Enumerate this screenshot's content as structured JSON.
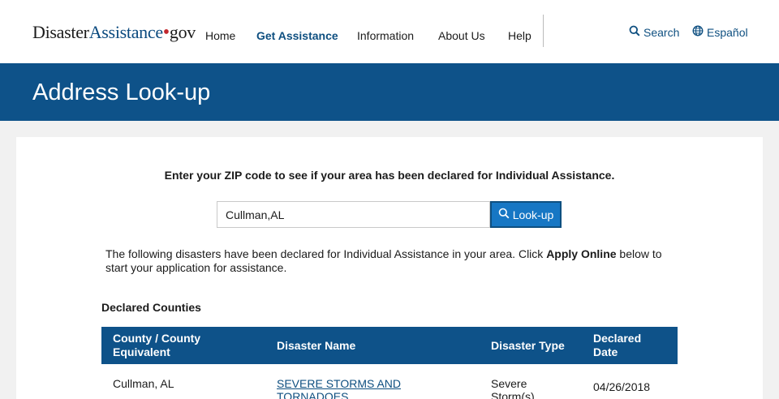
{
  "header": {
    "logo": {
      "part1": "Disaster",
      "part2": "Assistance",
      "dot": "•",
      "part3": "gov"
    },
    "nav": [
      {
        "label": "Home"
      },
      {
        "label": "Get Assistance"
      },
      {
        "label": "Information"
      },
      {
        "label": "About Us"
      },
      {
        "label": "Help"
      }
    ],
    "search_label": "Search",
    "language_label": "Español"
  },
  "banner": {
    "title": "Address Look-up"
  },
  "lookup": {
    "prompt": "Enter your ZIP code to see if your area has been declared for Individual Assistance.",
    "input_value": "Cullman,AL",
    "button_label": "Look-up"
  },
  "results": {
    "text_before": "The following disasters have been declared for Individual Assistance in your area. Click ",
    "text_bold": "Apply Online",
    "text_after": " below to start your application for assistance.",
    "section_heading": "Declared Counties"
  },
  "table": {
    "columns": [
      "County / County Equivalent",
      "Disaster Name",
      "Disaster Type",
      "Declared Date"
    ],
    "rows": [
      {
        "county": "Cullman, AL",
        "disaster_name": "SEVERE STORMS AND TORNADOES",
        "disaster_type": "Severe Storm(s)",
        "declared_date": "04/26/2018"
      }
    ]
  },
  "colors": {
    "banner": "#0e5289",
    "accent": "#1777c4",
    "link": "#0e4f80"
  }
}
